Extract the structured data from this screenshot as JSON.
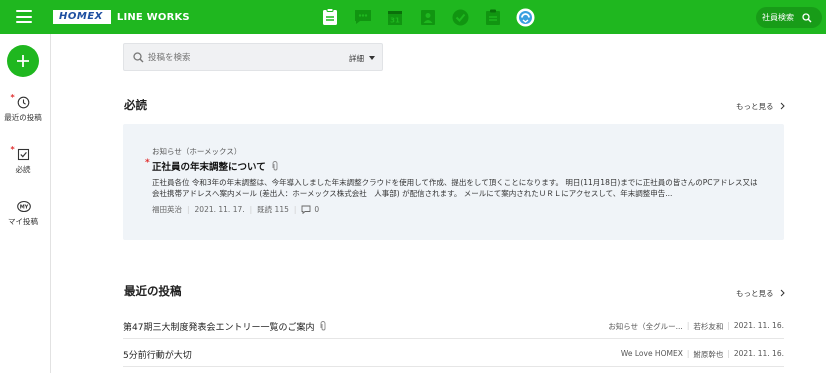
{
  "header": {
    "logo_primary": "HOMEX",
    "logo_secondary": "LINE WORKS",
    "apps": [
      "home-board-icon",
      "talk-icon",
      "calendar-icon",
      "contacts-icon",
      "task-icon",
      "form-icon",
      "drive-icon"
    ],
    "member_search_label": "社員検索",
    "accent_color": "#1fb71f"
  },
  "sidebar": {
    "items": [
      {
        "label": "最近の投稿",
        "icon": "clock-icon",
        "marked": true
      },
      {
        "label": "必読",
        "icon": "checkbox-icon",
        "marked": true
      },
      {
        "label": "マイ投稿",
        "icon": "my-icon",
        "marked": false
      }
    ]
  },
  "search": {
    "placeholder": "投稿を検索",
    "detail_label": "詳細"
  },
  "must_read": {
    "title": "必読",
    "more_label": "もっと見る",
    "post": {
      "category": "お知らせ（ホーメックス）",
      "title": "正社員の年末調整について",
      "body": "正社員各位 令和3年の年末調整は、今年導入しました年末調整クラウドを使用して作成、提出をして頂くことになります。 明日(11月18日)までに正社員の皆さんのPCアドレス又は会社携帯アドレスへ案内メール (差出人：ホーメックス株式会社　人事部) が配信されます。 メールにて案内されたＵＲＬにアクセスして、年末調整申告...",
      "author": "福田英治",
      "date": "2021. 11. 17.",
      "read_label": "既読 115",
      "comments": "0"
    }
  },
  "recent": {
    "title": "最近の投稿",
    "more_label": "もっと見る",
    "rows": [
      {
        "title": "第47期三大制度発表会エントリー一覧のご案内",
        "board": "お知らせ（全グルー...",
        "author": "若杉友和",
        "date": "2021. 11. 16."
      },
      {
        "title": "5分前行動が大切",
        "board": "We Love HOMEX",
        "author": "鮒原幹也",
        "date": "2021. 11. 16."
      }
    ]
  }
}
